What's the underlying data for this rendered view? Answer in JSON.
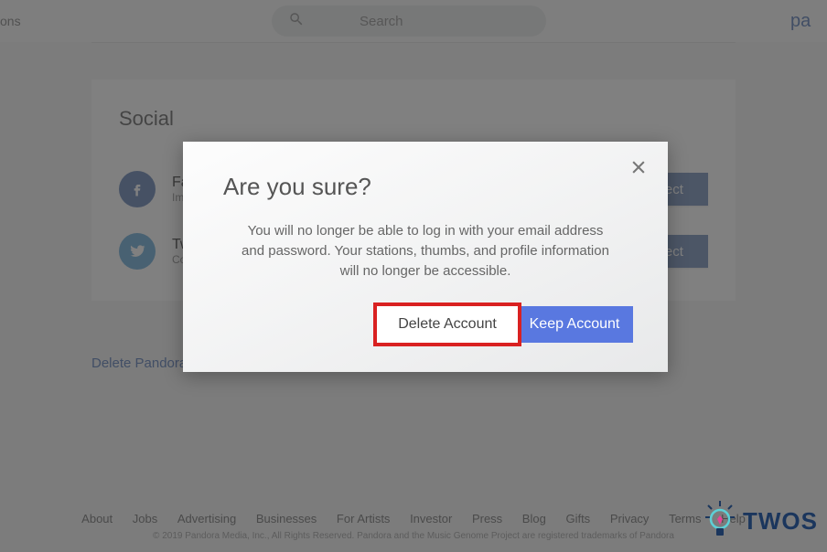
{
  "topbar": {
    "left_fragment": "ons",
    "search_placeholder": "Search",
    "brand_fragment": "pa"
  },
  "social": {
    "title": "Social",
    "items": [
      {
        "name": "Fa",
        "sub": "Im",
        "button": "Connect"
      },
      {
        "name": "Tw",
        "sub": "Co",
        "button": "Connect"
      }
    ]
  },
  "delete_link": "Delete Pandora Account",
  "footer": {
    "links": [
      "About",
      "Jobs",
      "Advertising",
      "Businesses",
      "For Artists",
      "Investor",
      "Press",
      "Blog",
      "Gifts",
      "Privacy",
      "Terms",
      "Help"
    ],
    "copyright": "© 2019 Pandora Media, Inc., All Rights Reserved. Pandora and the Music Genome Project are registered trademarks of Pandora"
  },
  "modal": {
    "title": "Are you sure?",
    "body": "You will no longer be able to log in with your email address and password. Your stations, thumbs, and profile information will no longer be accessible.",
    "delete_label": "Delete Account",
    "keep_label": "Keep Account"
  },
  "watermark": {
    "text": "TWOS"
  },
  "colors": {
    "primary_blue": "#5978e0",
    "highlight_red": "#d92121"
  }
}
